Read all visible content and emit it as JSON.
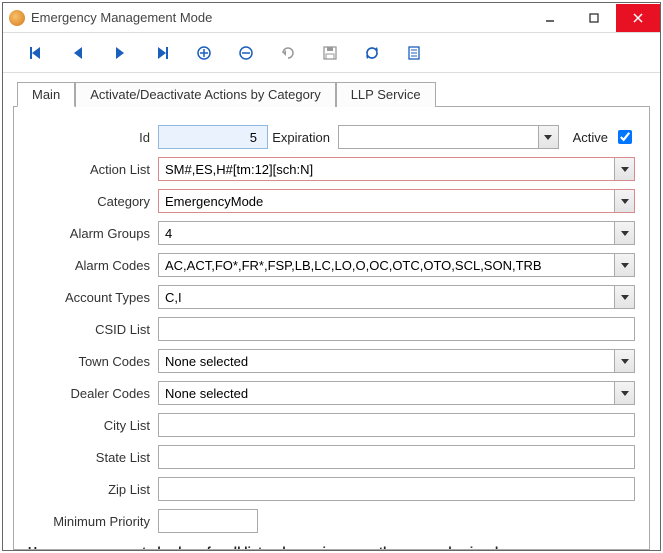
{
  "window": {
    "title": "Emergency Management Mode"
  },
  "toolbar": {
    "first": "first",
    "prev": "prev",
    "next": "next",
    "last": "last",
    "add": "add",
    "remove": "remove",
    "undo": "undo",
    "save": "save",
    "refresh": "refresh",
    "notes": "notes"
  },
  "tabs": {
    "main": "Main",
    "actions": "Activate/Deactivate Actions by Category",
    "llp": "LLP Service"
  },
  "main": {
    "labels": {
      "id": "Id",
      "expiration": "Expiration",
      "active": "Active",
      "action_list": "Action List",
      "category": "Category",
      "alarm_groups": "Alarm Groups",
      "alarm_codes": "Alarm Codes",
      "account_types": "Account Types",
      "csid_list": "CSID List",
      "town_codes": "Town Codes",
      "dealer_codes": "Dealer Codes",
      "city_list": "City List",
      "state_list": "State List",
      "zip_list": "Zip List",
      "minimum_priority": "Minimum Priority"
    },
    "values": {
      "id": "5",
      "expiration": "",
      "active_checked": true,
      "action_list": "SM#,ES,H#[tm:12][sch:N]",
      "category": "EmergencyMode",
      "alarm_groups": "4",
      "alarm_codes": "AC,ACT,FO*,FR*,FSP,LB,LC,LO,O,OC,OTC,OTO,SCL,SON,TRB",
      "account_types": "C,I",
      "csid_list": "",
      "town_codes": "None selected",
      "dealer_codes": "None selected",
      "city_list": "",
      "state_list": "",
      "zip_list": "",
      "minimum_priority": ""
    },
    "hint": "Use comma separated values for all lists when using more than one value in a box"
  }
}
